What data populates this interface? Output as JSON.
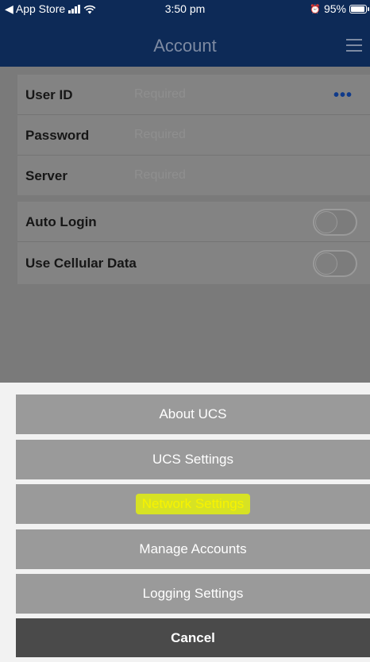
{
  "status_bar": {
    "back_app": "◀ App Store",
    "time": "3:50 pm",
    "battery": "95%",
    "alarm_glyph": "⏰"
  },
  "header": {
    "title": "Account",
    "menu_icon": "hamburger-icon"
  },
  "form": {
    "fields": [
      {
        "label": "User ID",
        "placeholder": "Required"
      },
      {
        "label": "Password",
        "placeholder": "Required"
      },
      {
        "label": "Server",
        "placeholder": "Required"
      }
    ],
    "more_glyph": "•••",
    "toggles": [
      {
        "label": "Auto Login",
        "on": false
      },
      {
        "label": "Use Cellular Data",
        "on": false
      }
    ]
  },
  "action_sheet": {
    "buttons": [
      {
        "label": "About UCS"
      },
      {
        "label": "UCS Settings"
      },
      {
        "label": "Network Settings",
        "highlighted": true
      },
      {
        "label": "Manage Accounts"
      },
      {
        "label": "Logging Settings"
      }
    ],
    "cancel": "Cancel"
  },
  "colors": {
    "nav": "#0d2a57",
    "highlight": "#f7f300"
  }
}
